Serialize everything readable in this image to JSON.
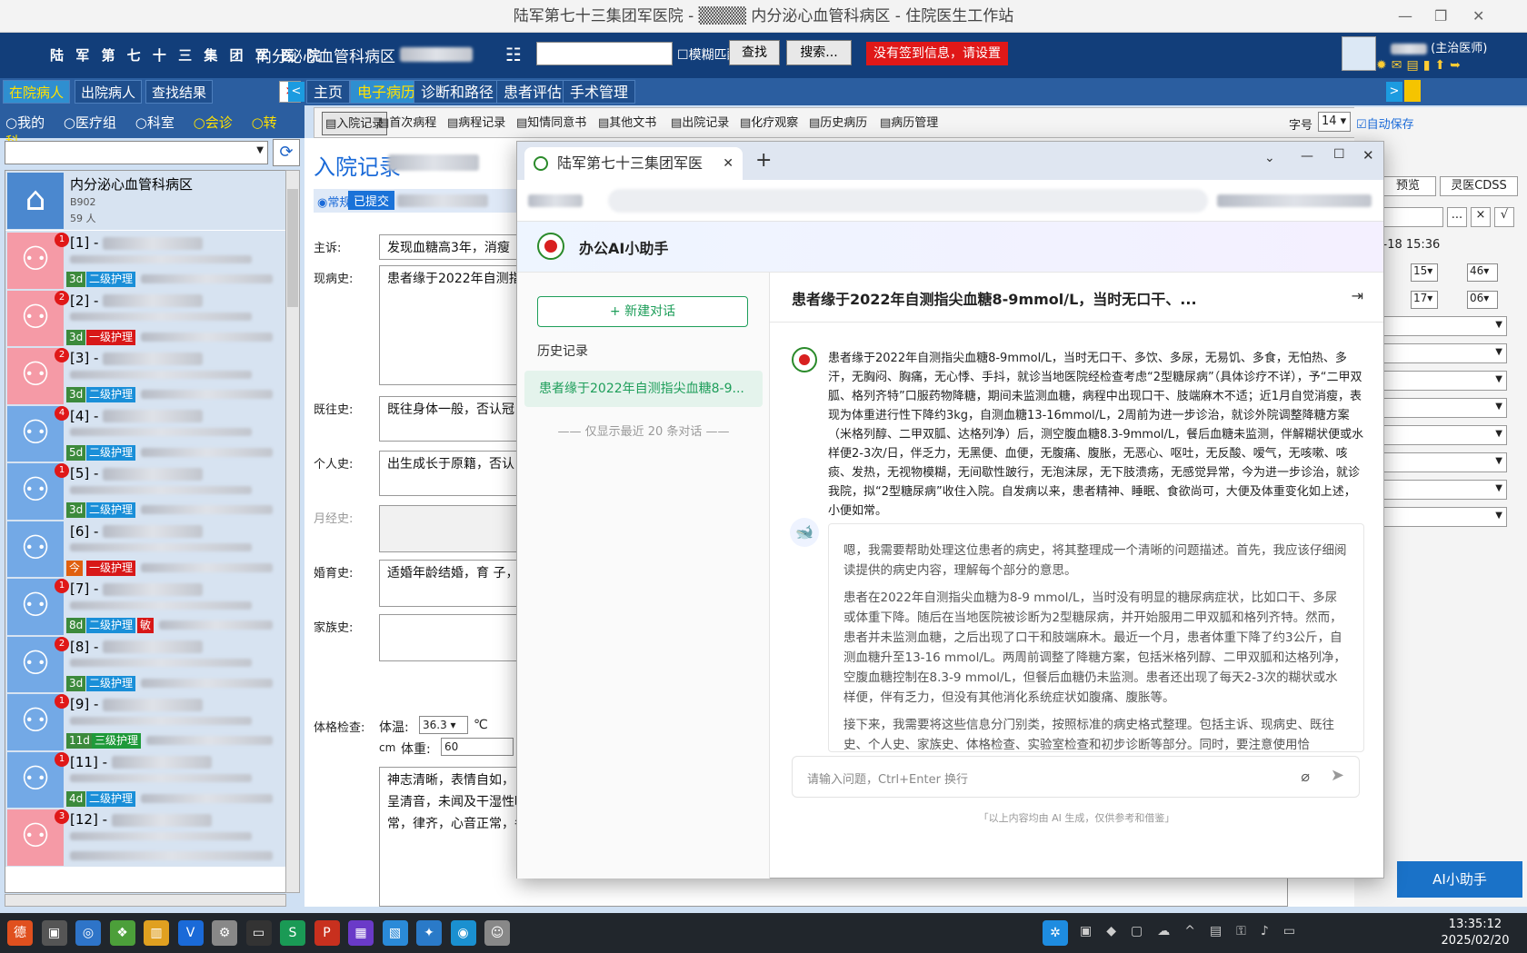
{
  "window": {
    "title": "陆军第七十三集团军医院 - ▒▒▒▒ 内分泌心血管科病区 - 住院医生工作站"
  },
  "topbar": {
    "hospital": "陆 军 第 七 十 三 集 团 军 医 院",
    "ward": "内分泌心血管科病区",
    "fuzzy_label": "模糊匹配",
    "find_btn": "查找",
    "search_btn": "搜索...",
    "signin_msg": "没有签到信息，请设置",
    "doctor_role": "(主治医师)"
  },
  "left": {
    "tabs": [
      "在院病人",
      "出院病人",
      "查找结果"
    ],
    "close": "×",
    "radios": [
      "我的",
      "医疗组",
      "科室",
      "会诊",
      "转科"
    ],
    "ward_item": {
      "name": "内分泌心血管科病区",
      "code": "B902",
      "count": "59 人"
    },
    "patients": [
      {
        "id": "[1]",
        "badge": "1",
        "days": "3d",
        "care": "二级护理",
        "av": "pink"
      },
      {
        "id": "[2]",
        "badge": "2",
        "days": "3d",
        "care": "一级护理",
        "av": "pink"
      },
      {
        "id": "[3]",
        "badge": "2",
        "days": "3d",
        "care": "二级护理",
        "av": "pink"
      },
      {
        "id": "[4]",
        "badge": "4",
        "days": "5d",
        "care": "二级护理",
        "av": "blue"
      },
      {
        "id": "[5]",
        "badge": "1",
        "days": "3d",
        "care": "二级护理",
        "av": "blue"
      },
      {
        "id": "[6]",
        "badge": "",
        "days": "今",
        "care": "一级护理",
        "av": "blue"
      },
      {
        "id": "[7]",
        "badge": "1",
        "days": "8d",
        "care": "二级护理",
        "extra": "敏",
        "av": "blue"
      },
      {
        "id": "[8]",
        "badge": "2",
        "days": "3d",
        "care": "二级护理",
        "av": "blue"
      },
      {
        "id": "[9]",
        "badge": "1",
        "days": "11d",
        "care": "三级护理",
        "av": "blue"
      },
      {
        "id": "[11]",
        "badge": "1",
        "days": "4d",
        "care": "二级护理",
        "av": "blue"
      },
      {
        "id": "[12]",
        "badge": "3",
        "days": "",
        "care": "",
        "av": "pink"
      }
    ]
  },
  "main": {
    "tabs": [
      "主页",
      "电子病历",
      "诊断和路径",
      "患者评估",
      "手术管理"
    ],
    "subtabs": [
      "入院记录",
      "首次病程",
      "病程记录",
      "知情同意书",
      "其他文书",
      "出院记录",
      "化疗观察",
      "历史病历",
      "病历管理"
    ],
    "font_label": "字号",
    "font_size": "14",
    "autosave": "自动保存",
    "preview": "预览",
    "cdss": "灵医CDSS",
    "datetime": "5-02-18 15:36",
    "record_title": "入院记录",
    "normal_label": "常规",
    "submitted": "已提交",
    "fields": [
      {
        "label": "主诉:",
        "text": "发现血糖高3年，消瘦"
      },
      {
        "label": "现病史:",
        "text": "患者缘于2022年自测指 查考虑“2型糖尿病” 瘦，表现为体重进行性 血糖8.3-9mmol/L，餐后 咳痰、发热，无视物模 来，患者精神、睡眠、"
      },
      {
        "label": "既往史:",
        "text": "既往身体一般，否认冠"
      },
      {
        "label": "个人史:",
        "text": "出生成长于原籍，否认 不洁性生活史，无宗教"
      },
      {
        "label": "月经史:",
        "text": ""
      },
      {
        "label": "婚育史:",
        "text": "适婚年龄结婚，育 子，配偶体"
      },
      {
        "label": "家族史:",
        "text": ""
      },
      {
        "label": "体格检查:",
        "text": "神志清晰，表情自如， 明显水肿，未见皮下出 廓正常无畸形，外耳道 质红，扁桃体无肿大， 管居中，甲状腺正常， 语颤正常，未触及胸膜摩擦感，双肺叩诊呈清音，未闻及干湿性啰音。心前区无隆起，心尖搏动正常，心尖搏动位于左侧第5肋间锁骨中线内0.5cm处， 未触及震颤，心包摩擦感未触及，心浊音界正常，律齐，心音正常，各瓣膜听诊区未闻及杂音，心包摩擦音未闻及，周围血管征阴性。腹部正常，未见"
      }
    ],
    "temp_label": "体温:",
    "temp_value": "36.3",
    "temp_unit": "℃",
    "weight_label": "体重:",
    "weight_value": "60",
    "weight_unit_cm": "cm",
    "ai_button": "AI小助手",
    "right_times": [
      "15",
      "46",
      "17",
      "06"
    ]
  },
  "assistant": {
    "tab_title": "陆军第七十三集团军医",
    "app_title": "办公AI小助手",
    "new_chat": "+ 新建对话",
    "history_label": "历史记录",
    "history_item": "患者缘于2022年自测指尖血糖8-9...",
    "history_note": "仅显示最近 20 条对话",
    "conv_title": "患者缘于2022年自测指尖血糖8-9mmol/L，当时无口干、...",
    "user_message": "患者缘于2022年自测指尖血糖8-9mmol/L，当时无口干、多饮、多尿，无易饥、多食，无怕热、多汗，无胸闷、胸痛，无心悸、手抖，就诊当地医院经检查考虑“2型糖尿病”（具体诊疗不详），予“二甲双胍、格列齐特”口服药物降糖，期间未监测血糖，病程中出现口干、肢端麻木不适；近1月自觉消瘦，表现为体重进行性下降约3kg，自测血糖13-16mmol/L，2周前为进一步诊治，就诊外院调整降糖方案（米格列醇、二甲双胍、达格列净）后，测空腹血糖8.3-9mmol/L，餐后血糖未监测，伴解糊状便或水样便2-3次/日，伴乏力，无黑便、血便，无腹痛、腹胀，无恶心、呕吐，无反酸、嗳气，无咳嗽、咳痰、发热，无视物模糊，无间歇性跛行，无泡沫尿，无下肢溃疡，无感觉异常，今为进一步诊治，就诊我院，拟“2型糖尿病”收住入院。自发病以来，患者精神、睡眠、食欲尚可，大便及体重变化如上述，小便如常。",
    "ai_paragraphs": [
      "嗯，我需要帮助处理这位患者的病史，将其整理成一个清晰的问题描述。首先，我应该仔细阅读提供的病史内容，理解每个部分的意思。",
      "患者在2022年自测指尖血糖为8-9 mmol/L，当时没有明显的糖尿病症状，比如口干、多尿或体重下降。随后在当地医院被诊断为2型糖尿病，并开始服用二甲双胍和格列齐特。然而，患者并未监测血糖，之后出现了口干和肢端麻木。最近一个月，患者体重下降了约3公斤，自测血糖升至13-16 mmol/L。两周前调整了降糖方案，包括米格列醇、二甲双胍和达格列净，空腹血糖控制在8.3-9 mmol/L，但餐后血糖仍未监测。患者还出现了每天2-3次的糊状或水样便，伴有乏力，但没有其他消化系统症状如腹痛、腹胀等。",
      "接下来，我需要将这些信息分门别类，按照标准的病史格式整理。包括主诉、现病史、既往史、个人史、家族史、体格检查、实验室检查和初步诊断等部分。同时，要注意使用恰"
    ],
    "input_placeholder": "请输入问题，Ctrl+Enter 换行",
    "disclaimer": "「以上内容均由 AI 生成，仅供参考和借鉴」"
  },
  "taskbar": {
    "time": "13:35:12",
    "date": "2025/02/20"
  }
}
